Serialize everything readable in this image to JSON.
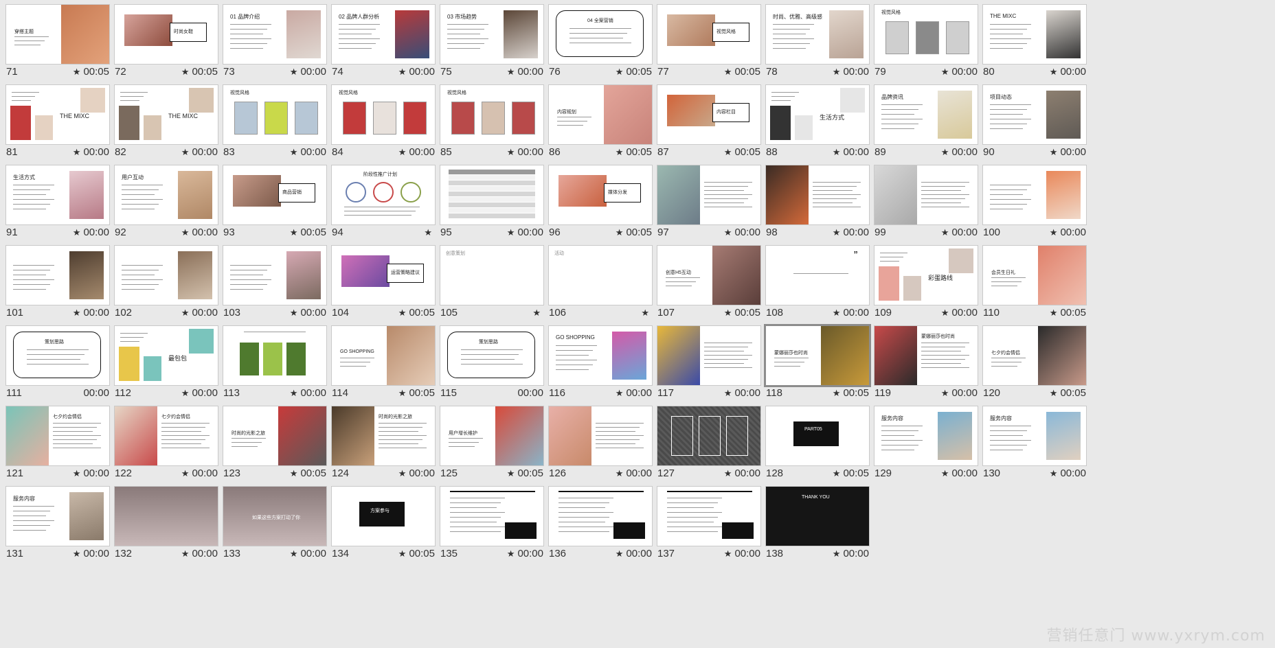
{
  "watermark": "营销任意门 www.yxrym.com",
  "slides": [
    {
      "num": "71",
      "time": "00:05",
      "star": true,
      "style": "photo-right",
      "title": "穿搭主题",
      "colors": [
        "#c87a52",
        "#e3a27b"
      ]
    },
    {
      "num": "72",
      "time": "00:05",
      "star": true,
      "style": "photo-box",
      "title": "时尚女鞋",
      "colors": [
        "#d6a39b",
        "#8d4b3c"
      ]
    },
    {
      "num": "73",
      "time": "00:00",
      "star": true,
      "style": "text-photo",
      "title": "01 品牌介绍",
      "colors": [
        "#c9a9a2",
        "#e0d8d2"
      ]
    },
    {
      "num": "74",
      "time": "00:00",
      "star": true,
      "style": "text-photo",
      "title": "02 品牌人群分析",
      "colors": [
        "#b83a3a",
        "#384e78"
      ]
    },
    {
      "num": "75",
      "time": "00:00",
      "star": true,
      "style": "text-photo",
      "title": "03 市场趋势",
      "colors": [
        "#5b4637",
        "#d7d1cc"
      ]
    },
    {
      "num": "76",
      "time": "00:05",
      "star": true,
      "style": "rounded",
      "title": "04 全案营销",
      "colors": [
        "#111111",
        "#ffffff"
      ]
    },
    {
      "num": "77",
      "time": "00:05",
      "star": true,
      "style": "photo-box",
      "title": "视觉风格",
      "colors": [
        "#d8b9a2",
        "#b07a5c"
      ]
    },
    {
      "num": "78",
      "time": "00:00",
      "star": true,
      "style": "text-photo",
      "title": "时尚、优雅、高级感",
      "colors": [
        "#e2d6cc",
        "#b9a395"
      ]
    },
    {
      "num": "79",
      "time": "00:00",
      "star": true,
      "style": "text-cols",
      "title": "视觉风格",
      "colors": [
        "#cfcfcf",
        "#8a8a8a"
      ]
    },
    {
      "num": "80",
      "time": "00:00",
      "star": true,
      "style": "text-photo",
      "title": "THE MIXC",
      "colors": [
        "#d9d4ce",
        "#333333"
      ]
    },
    {
      "num": "81",
      "time": "00:00",
      "star": true,
      "style": "collage",
      "title": "THE MIXC",
      "colors": [
        "#c23b3b",
        "#e5d2c2"
      ]
    },
    {
      "num": "82",
      "time": "00:00",
      "star": true,
      "style": "collage",
      "title": "THE MIXC",
      "colors": [
        "#7a6a5d",
        "#d8c5b2"
      ]
    },
    {
      "num": "83",
      "time": "00:00",
      "star": true,
      "style": "text-cols",
      "title": "视觉风格",
      "colors": [
        "#b7c7d6",
        "#c9d94a"
      ]
    },
    {
      "num": "84",
      "time": "00:00",
      "star": true,
      "style": "text-cols",
      "title": "视觉风格",
      "colors": [
        "#c23b3b",
        "#e8e1dc"
      ]
    },
    {
      "num": "85",
      "time": "00:00",
      "star": true,
      "style": "text-cols",
      "title": "视觉风格",
      "colors": [
        "#b84a4a",
        "#d6c1b0"
      ]
    },
    {
      "num": "86",
      "time": "00:05",
      "star": true,
      "style": "photo-right",
      "title": "内容规划",
      "colors": [
        "#e3a59a",
        "#c8837a"
      ]
    },
    {
      "num": "87",
      "time": "00:05",
      "star": true,
      "style": "photo-box",
      "title": "内容栏目",
      "colors": [
        "#d2643a",
        "#c8a88a"
      ]
    },
    {
      "num": "88",
      "time": "00:00",
      "star": true,
      "style": "collage",
      "title": "生活方式",
      "colors": [
        "#333333",
        "#e6e6e6"
      ]
    },
    {
      "num": "89",
      "time": "00:00",
      "star": true,
      "style": "text-photo",
      "title": "品牌资讯",
      "colors": [
        "#e8e3d6",
        "#d8c99a"
      ]
    },
    {
      "num": "90",
      "time": "00:00",
      "star": true,
      "style": "text-photo",
      "title": "项目动态",
      "colors": [
        "#8d7f70",
        "#5f5a55"
      ]
    },
    {
      "num": "91",
      "time": "00:00",
      "star": true,
      "style": "text-photo",
      "title": "生活方式",
      "colors": [
        "#e6c9cf",
        "#b77a86"
      ]
    },
    {
      "num": "92",
      "time": "00:00",
      "star": true,
      "style": "text-photo",
      "title": "用户互动",
      "colors": [
        "#d9b89a",
        "#b08866"
      ]
    },
    {
      "num": "93",
      "time": "00:05",
      "star": true,
      "style": "photo-box",
      "title": "商品营销",
      "colors": [
        "#c79b8a",
        "#7c5a4a"
      ]
    },
    {
      "num": "94",
      "time": "",
      "star": true,
      "style": "circles",
      "title": "阶段性推广计划",
      "colors": [
        "#6a7fb0",
        "#c84a4a"
      ]
    },
    {
      "num": "95",
      "time": "00:00",
      "star": true,
      "style": "table",
      "title": "",
      "colors": [
        "#9a9a9a",
        "#d6d6d6"
      ]
    },
    {
      "num": "96",
      "time": "00:05",
      "star": true,
      "style": "photo-box",
      "title": "媒体分发",
      "colors": [
        "#e6a79a",
        "#c8603e"
      ]
    },
    {
      "num": "97",
      "time": "00:00",
      "star": true,
      "style": "photo-left",
      "title": "",
      "colors": [
        "#9bb8b0",
        "#6d7c88"
      ]
    },
    {
      "num": "98",
      "time": "00:00",
      "star": true,
      "style": "photo-left",
      "title": "",
      "colors": [
        "#3a2b24",
        "#d46a3a"
      ]
    },
    {
      "num": "99",
      "time": "00:00",
      "star": true,
      "style": "photo-left",
      "title": "",
      "colors": [
        "#d8d8d8",
        "#a9a9a9"
      ]
    },
    {
      "num": "100",
      "time": "00:00",
      "star": true,
      "style": "text-photo",
      "title": "",
      "colors": [
        "#e9885a",
        "#f0d8c8"
      ]
    },
    {
      "num": "101",
      "time": "00:00",
      "star": true,
      "style": "text-photo",
      "title": "",
      "colors": [
        "#4f3e30",
        "#a58a6d"
      ]
    },
    {
      "num": "102",
      "time": "00:00",
      "star": true,
      "style": "text-photo",
      "title": "",
      "colors": [
        "#8a6f58",
        "#d3c1ad"
      ]
    },
    {
      "num": "103",
      "time": "00:00",
      "star": true,
      "style": "text-photo",
      "title": "",
      "colors": [
        "#d6a9b3",
        "#7b6a60"
      ]
    },
    {
      "num": "104",
      "time": "00:05",
      "star": true,
      "style": "photo-box",
      "title": "运营策略建议",
      "colors": [
        "#d070b8",
        "#6a4aa0"
      ]
    },
    {
      "num": "105",
      "time": "",
      "star": true,
      "style": "blank",
      "title": "创意策划",
      "colors": [
        "#ffffff",
        "#ffffff"
      ]
    },
    {
      "num": "106",
      "time": "",
      "star": true,
      "style": "blank",
      "title": "活动",
      "colors": [
        "#ffffff",
        "#ffffff"
      ]
    },
    {
      "num": "107",
      "time": "00:05",
      "star": true,
      "style": "photo-right",
      "title": "创意H5互动",
      "colors": [
        "#a67b73",
        "#5a3e3a"
      ]
    },
    {
      "num": "108",
      "time": "00:00",
      "star": true,
      "style": "quote",
      "title": "",
      "colors": [
        "#111111",
        "#ffffff"
      ]
    },
    {
      "num": "109",
      "time": "00:00",
      "star": true,
      "style": "collage",
      "title": "彩蛋路线",
      "colors": [
        "#e8a49a",
        "#d6c8bf"
      ]
    },
    {
      "num": "110",
      "time": "00:05",
      "star": true,
      "style": "photo-right",
      "title": "会员生日礼",
      "colors": [
        "#e0806a",
        "#f0c1b2"
      ]
    },
    {
      "num": "111",
      "time": "00:00",
      "star": false,
      "style": "rounded",
      "title": "策划思路",
      "colors": [
        "#111111",
        "#ffffff"
      ]
    },
    {
      "num": "112",
      "time": "00:00",
      "star": true,
      "style": "collage",
      "title": "最包包",
      "colors": [
        "#e8c64a",
        "#7ac4bc"
      ]
    },
    {
      "num": "113",
      "time": "00:00",
      "star": true,
      "style": "cards",
      "title": "",
      "colors": [
        "#4f7a2e",
        "#9bc24a"
      ]
    },
    {
      "num": "114",
      "time": "00:05",
      "star": true,
      "style": "photo-right",
      "title": "GO SHOPPING",
      "colors": [
        "#b88a6a",
        "#e6cdb8"
      ]
    },
    {
      "num": "115",
      "time": "00:00",
      "star": false,
      "style": "rounded",
      "title": "策划思路",
      "colors": [
        "#111111",
        "#ffffff"
      ]
    },
    {
      "num": "116",
      "time": "00:00",
      "star": true,
      "style": "text-photo",
      "title": "GO SHOPPING",
      "colors": [
        "#d45aa8",
        "#6aa6d8"
      ]
    },
    {
      "num": "117",
      "time": "00:00",
      "star": true,
      "style": "photo-left",
      "title": "",
      "colors": [
        "#e8b83a",
        "#3a4aa8"
      ]
    },
    {
      "num": "118",
      "time": "00:05",
      "star": true,
      "style": "photo-right",
      "title": "蒙娜丽莎也时尚",
      "colors": [
        "#6a5a2a",
        "#c89a3a"
      ],
      "selected": true
    },
    {
      "num": "119",
      "time": "00:00",
      "star": true,
      "style": "photo-left",
      "title": "蒙娜丽莎也时尚",
      "colors": [
        "#c84a4a",
        "#2a2a2a"
      ]
    },
    {
      "num": "120",
      "time": "00:05",
      "star": true,
      "style": "photo-right",
      "title": "七夕约会情侣",
      "colors": [
        "#2a2a2a",
        "#c89a8a"
      ]
    },
    {
      "num": "121",
      "time": "00:00",
      "star": true,
      "style": "photo-left",
      "title": "七夕约会情侣",
      "colors": [
        "#7ac4b8",
        "#e6b0a0"
      ]
    },
    {
      "num": "122",
      "time": "00:00",
      "star": true,
      "style": "photo-left",
      "title": "七夕约会情侣",
      "colors": [
        "#e6d6c6",
        "#c84a4a"
      ]
    },
    {
      "num": "123",
      "time": "00:05",
      "star": true,
      "style": "photo-right",
      "title": "时尚的光影之旅",
      "colors": [
        "#c83a3a",
        "#5a5a5a"
      ]
    },
    {
      "num": "124",
      "time": "00:00",
      "star": true,
      "style": "photo-left",
      "title": "时尚的光影之旅",
      "colors": [
        "#4a3a2a",
        "#c8a07a"
      ]
    },
    {
      "num": "125",
      "time": "00:05",
      "star": true,
      "style": "photo-right",
      "title": "用户增长维护",
      "colors": [
        "#d84a3a",
        "#8ab4c8"
      ]
    },
    {
      "num": "126",
      "time": "00:00",
      "star": true,
      "style": "photo-left",
      "title": "",
      "colors": [
        "#e8b0a8",
        "#c88a6a"
      ]
    },
    {
      "num": "127",
      "time": "00:00",
      "star": true,
      "style": "dark-pattern",
      "title": "",
      "colors": [
        "#4a4a4a",
        "#ffffff"
      ]
    },
    {
      "num": "128",
      "time": "00:05",
      "star": true,
      "style": "black-box",
      "title": "PART05",
      "colors": [
        "#111111",
        "#ffffff"
      ]
    },
    {
      "num": "129",
      "time": "00:00",
      "star": true,
      "style": "text-photo",
      "title": "服务内容",
      "colors": [
        "#7ab0d0",
        "#d6c0a8"
      ]
    },
    {
      "num": "130",
      "time": "00:00",
      "star": true,
      "style": "text-photo",
      "title": "服务内容",
      "colors": [
        "#8ab8d8",
        "#e0d0c0"
      ]
    },
    {
      "num": "131",
      "time": "00:00",
      "star": true,
      "style": "text-photo",
      "title": "服务内容",
      "colors": [
        "#c8b8a8",
        "#8a7a6a"
      ]
    },
    {
      "num": "132",
      "time": "00:00",
      "star": true,
      "style": "dark-photo",
      "title": "",
      "colors": [
        "#8a7a7a",
        "#c8b8b8"
      ]
    },
    {
      "num": "133",
      "time": "00:00",
      "star": true,
      "style": "dark-photo",
      "title": "如果这些方案打动了你",
      "colors": [
        "#8a7a7a",
        "#c8b8b8"
      ]
    },
    {
      "num": "134",
      "time": "00:05",
      "star": true,
      "style": "black-box",
      "title": "方案参与",
      "colors": [
        "#111111",
        "#ffffff"
      ]
    },
    {
      "num": "135",
      "time": "00:00",
      "star": true,
      "style": "list-black",
      "title": "",
      "colors": [
        "#111111",
        "#ffffff"
      ]
    },
    {
      "num": "136",
      "time": "00:00",
      "star": true,
      "style": "list-black",
      "title": "",
      "colors": [
        "#111111",
        "#ffffff"
      ]
    },
    {
      "num": "137",
      "time": "00:00",
      "star": true,
      "style": "list-black",
      "title": "",
      "colors": [
        "#111111",
        "#ffffff"
      ]
    },
    {
      "num": "138",
      "time": "00:00",
      "star": true,
      "style": "thanks",
      "title": "THANK YOU",
      "colors": [
        "#111111",
        "#ffffff"
      ]
    }
  ]
}
